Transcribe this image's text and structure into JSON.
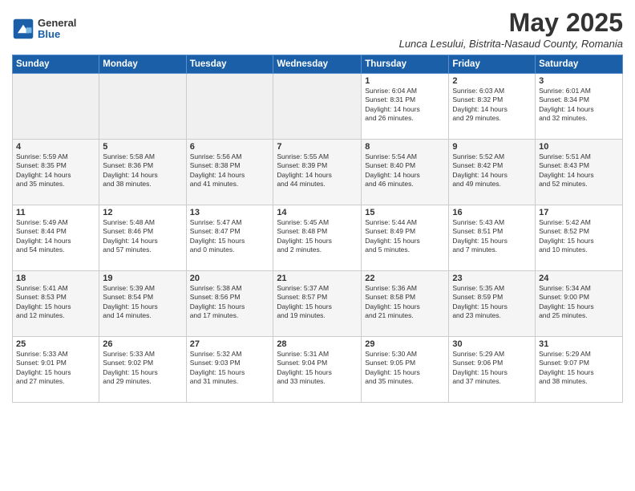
{
  "header": {
    "logo_general": "General",
    "logo_blue": "Blue",
    "month_title": "May 2025",
    "subtitle": "Lunca Lesului, Bistrita-Nasaud County, Romania"
  },
  "weekdays": [
    "Sunday",
    "Monday",
    "Tuesday",
    "Wednesday",
    "Thursday",
    "Friday",
    "Saturday"
  ],
  "weeks": [
    [
      {
        "day": "",
        "info": ""
      },
      {
        "day": "",
        "info": ""
      },
      {
        "day": "",
        "info": ""
      },
      {
        "day": "",
        "info": ""
      },
      {
        "day": "1",
        "info": "Sunrise: 6:04 AM\nSunset: 8:31 PM\nDaylight: 14 hours\nand 26 minutes."
      },
      {
        "day": "2",
        "info": "Sunrise: 6:03 AM\nSunset: 8:32 PM\nDaylight: 14 hours\nand 29 minutes."
      },
      {
        "day": "3",
        "info": "Sunrise: 6:01 AM\nSunset: 8:34 PM\nDaylight: 14 hours\nand 32 minutes."
      }
    ],
    [
      {
        "day": "4",
        "info": "Sunrise: 5:59 AM\nSunset: 8:35 PM\nDaylight: 14 hours\nand 35 minutes."
      },
      {
        "day": "5",
        "info": "Sunrise: 5:58 AM\nSunset: 8:36 PM\nDaylight: 14 hours\nand 38 minutes."
      },
      {
        "day": "6",
        "info": "Sunrise: 5:56 AM\nSunset: 8:38 PM\nDaylight: 14 hours\nand 41 minutes."
      },
      {
        "day": "7",
        "info": "Sunrise: 5:55 AM\nSunset: 8:39 PM\nDaylight: 14 hours\nand 44 minutes."
      },
      {
        "day": "8",
        "info": "Sunrise: 5:54 AM\nSunset: 8:40 PM\nDaylight: 14 hours\nand 46 minutes."
      },
      {
        "day": "9",
        "info": "Sunrise: 5:52 AM\nSunset: 8:42 PM\nDaylight: 14 hours\nand 49 minutes."
      },
      {
        "day": "10",
        "info": "Sunrise: 5:51 AM\nSunset: 8:43 PM\nDaylight: 14 hours\nand 52 minutes."
      }
    ],
    [
      {
        "day": "11",
        "info": "Sunrise: 5:49 AM\nSunset: 8:44 PM\nDaylight: 14 hours\nand 54 minutes."
      },
      {
        "day": "12",
        "info": "Sunrise: 5:48 AM\nSunset: 8:46 PM\nDaylight: 14 hours\nand 57 minutes."
      },
      {
        "day": "13",
        "info": "Sunrise: 5:47 AM\nSunset: 8:47 PM\nDaylight: 15 hours\nand 0 minutes."
      },
      {
        "day": "14",
        "info": "Sunrise: 5:45 AM\nSunset: 8:48 PM\nDaylight: 15 hours\nand 2 minutes."
      },
      {
        "day": "15",
        "info": "Sunrise: 5:44 AM\nSunset: 8:49 PM\nDaylight: 15 hours\nand 5 minutes."
      },
      {
        "day": "16",
        "info": "Sunrise: 5:43 AM\nSunset: 8:51 PM\nDaylight: 15 hours\nand 7 minutes."
      },
      {
        "day": "17",
        "info": "Sunrise: 5:42 AM\nSunset: 8:52 PM\nDaylight: 15 hours\nand 10 minutes."
      }
    ],
    [
      {
        "day": "18",
        "info": "Sunrise: 5:41 AM\nSunset: 8:53 PM\nDaylight: 15 hours\nand 12 minutes."
      },
      {
        "day": "19",
        "info": "Sunrise: 5:39 AM\nSunset: 8:54 PM\nDaylight: 15 hours\nand 14 minutes."
      },
      {
        "day": "20",
        "info": "Sunrise: 5:38 AM\nSunset: 8:56 PM\nDaylight: 15 hours\nand 17 minutes."
      },
      {
        "day": "21",
        "info": "Sunrise: 5:37 AM\nSunset: 8:57 PM\nDaylight: 15 hours\nand 19 minutes."
      },
      {
        "day": "22",
        "info": "Sunrise: 5:36 AM\nSunset: 8:58 PM\nDaylight: 15 hours\nand 21 minutes."
      },
      {
        "day": "23",
        "info": "Sunrise: 5:35 AM\nSunset: 8:59 PM\nDaylight: 15 hours\nand 23 minutes."
      },
      {
        "day": "24",
        "info": "Sunrise: 5:34 AM\nSunset: 9:00 PM\nDaylight: 15 hours\nand 25 minutes."
      }
    ],
    [
      {
        "day": "25",
        "info": "Sunrise: 5:33 AM\nSunset: 9:01 PM\nDaylight: 15 hours\nand 27 minutes."
      },
      {
        "day": "26",
        "info": "Sunrise: 5:33 AM\nSunset: 9:02 PM\nDaylight: 15 hours\nand 29 minutes."
      },
      {
        "day": "27",
        "info": "Sunrise: 5:32 AM\nSunset: 9:03 PM\nDaylight: 15 hours\nand 31 minutes."
      },
      {
        "day": "28",
        "info": "Sunrise: 5:31 AM\nSunset: 9:04 PM\nDaylight: 15 hours\nand 33 minutes."
      },
      {
        "day": "29",
        "info": "Sunrise: 5:30 AM\nSunset: 9:05 PM\nDaylight: 15 hours\nand 35 minutes."
      },
      {
        "day": "30",
        "info": "Sunrise: 5:29 AM\nSunset: 9:06 PM\nDaylight: 15 hours\nand 37 minutes."
      },
      {
        "day": "31",
        "info": "Sunrise: 5:29 AM\nSunset: 9:07 PM\nDaylight: 15 hours\nand 38 minutes."
      }
    ]
  ]
}
